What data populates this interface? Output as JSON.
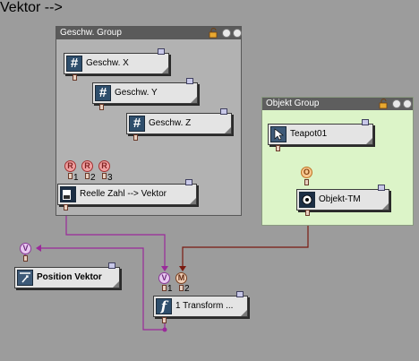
{
  "groups": {
    "speed": {
      "title": "Geschw. Group"
    },
    "object": {
      "title": "Objekt Group"
    }
  },
  "nodes": {
    "geschw_x": {
      "label": "Geschw. X",
      "icon": "hash-icon",
      "glyph": "#"
    },
    "geschw_y": {
      "label": "Geschw. Y",
      "icon": "hash-icon",
      "glyph": "#"
    },
    "geschw_z": {
      "label": "Geschw. Z",
      "icon": "hash-icon",
      "glyph": "#"
    },
    "real_to_vector": {
      "label": "Reelle Zahl --> Vektor",
      "icon": "converter-icon"
    },
    "teapot": {
      "label": "Teapot01",
      "icon": "pointer-icon"
    },
    "objekt_tm": {
      "label": "Objekt-TM",
      "icon": "object-transform-icon"
    },
    "position_vektor": {
      "label": "Position Vektor",
      "icon": "position-vector-icon"
    },
    "transform": {
      "label": "1 Transform ...",
      "icon": "function-icon",
      "glyph": "f"
    }
  },
  "ports": {
    "r_letter": "R",
    "v_letter": "V",
    "m_letter": "M",
    "o_letter": "O",
    "r_numbers": [
      "1",
      "2",
      "3"
    ],
    "vm_numbers": [
      "1",
      "2"
    ]
  },
  "colors": {
    "wire_red": "#a01010",
    "wire_purple": "#9a2a9a",
    "wire_dark_red": "#7a1a10",
    "wire_orange": "#e08a10",
    "speed_group_bg": "#b2b2b2",
    "object_group_bg": "#dcf4c8",
    "node_icon_bg": "#2e4e6c"
  }
}
